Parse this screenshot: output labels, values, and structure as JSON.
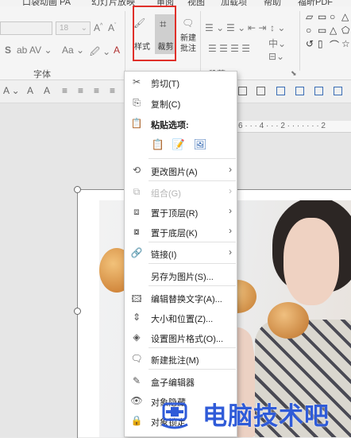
{
  "menubar": {
    "tabs": [
      "口袋动画 PA",
      "幻灯片放映",
      "审阅",
      "视图",
      "加载项",
      "帮助",
      "福昕PDF"
    ]
  },
  "ribbon": {
    "font_size": "18",
    "group_font_label": "字体",
    "group_paragraph_label": "段落",
    "style_label": "样式",
    "crop_label": "裁剪",
    "new_comment_label": "新建批注"
  },
  "ruler": {
    "text": "6 · · · 4 · · · 2 · · · · · · · 2"
  },
  "context_menu": {
    "items": [
      {
        "icon": "cut-icon",
        "label": "剪切(T)"
      },
      {
        "icon": "copy-icon",
        "label": "复制(C)"
      },
      {
        "icon": "paste-icon",
        "label": "粘贴选项:"
      },
      {
        "icon": "change-picture-icon",
        "label": "更改图片(A)"
      },
      {
        "icon": "group-icon",
        "label": "组合(G)"
      },
      {
        "icon": "bring-to-front-icon",
        "label": "置于顶层(R)"
      },
      {
        "icon": "send-to-back-icon",
        "label": "置于底层(K)"
      },
      {
        "icon": "link-icon",
        "label": "链接(I)"
      },
      {
        "icon": "",
        "label": "另存为图片(S)..."
      },
      {
        "icon": "alt-text-icon",
        "label": "编辑替换文字(A)..."
      },
      {
        "icon": "size-position-icon",
        "label": "大小和位置(Z)..."
      },
      {
        "icon": "format-picture-icon",
        "label": "设置图片格式(O)..."
      },
      {
        "icon": "new-comment-icon",
        "label": "新建批注(M)"
      },
      {
        "icon": "box-editor-icon",
        "label": "盒子编辑器"
      },
      {
        "icon": "hide-icon",
        "label": "对象隐藏"
      },
      {
        "icon": "lock-icon",
        "label": "对象锁定"
      }
    ]
  },
  "watermark": {
    "text": "电脑技术吧"
  },
  "colors": {
    "highlight_box": "#e0302a",
    "watermark": "#2f5bd8"
  }
}
